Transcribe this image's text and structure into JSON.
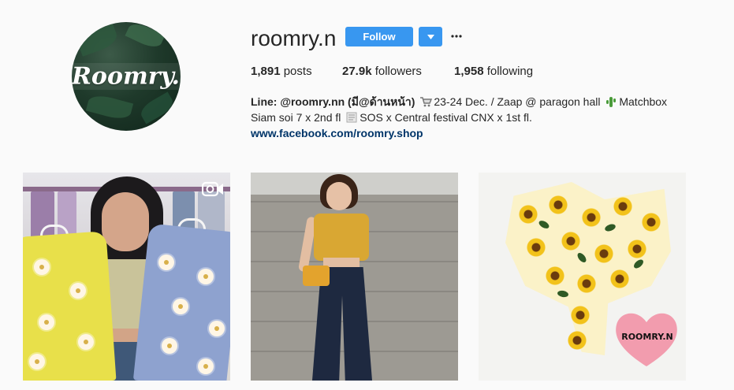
{
  "profile": {
    "username": "roomry.n",
    "avatar_text": "Roomry.n",
    "follow_label": "Follow",
    "dropdown_icon": "chevron-down-icon",
    "more_icon": "more-horizontal-icon"
  },
  "stats": [
    {
      "count": "1,891",
      "label": "posts"
    },
    {
      "count": "27.9k",
      "label": "followers"
    },
    {
      "count": "1,958",
      "label": "following"
    }
  ],
  "bio": {
    "name": "Line: @roomry.nn (มี@ด้านหน้า)",
    "line1_after_cart": "23-24 Dec. / Zaap @ paragon hall",
    "line1_after_cactus": "Matchbox",
    "line2_before_paper": "Siam soi 7 x 2nd fl",
    "line2_after_paper": "SOS x Central festival CNX x 1st fl.",
    "link": "www.facebook.com/roomry.shop"
  },
  "posts": [
    {
      "type": "video",
      "icon": "video-camera-icon"
    },
    {
      "type": "photo"
    },
    {
      "type": "photo",
      "watermark": "ROOMRY.N"
    }
  ],
  "colors": {
    "accent": "#3897f0",
    "link": "#003569",
    "background": "#fafafa",
    "text": "#262626"
  }
}
